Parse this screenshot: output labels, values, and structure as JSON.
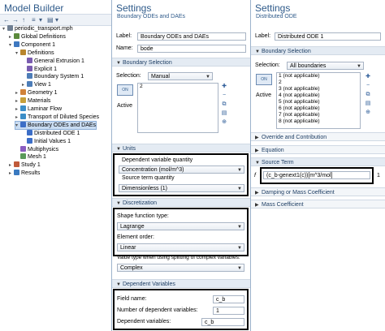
{
  "model_builder": {
    "title": "Model Builder",
    "toolbar": [
      "←",
      "→",
      "↑",
      "≡",
      "▾",
      "▤",
      "▾"
    ],
    "tree": [
      {
        "label": "periodic_transport.mph",
        "level": 0,
        "toggle": "▾",
        "icon": "file-icon",
        "color": "#6f7f92"
      },
      {
        "label": "Global Definitions",
        "level": 1,
        "toggle": "▸",
        "icon": "globe-icon",
        "color": "#5b8a3c"
      },
      {
        "label": "Component 1",
        "level": 1,
        "toggle": "▾",
        "icon": "component-icon",
        "color": "#3e78c0"
      },
      {
        "label": "Definitions",
        "level": 2,
        "toggle": "▾",
        "icon": "definitions-icon",
        "color": "#b8862e"
      },
      {
        "label": "General Extrusion 1",
        "level": 3,
        "toggle": "",
        "icon": "extrusion-icon",
        "color": "#7a5cb0"
      },
      {
        "label": "Explicit 1",
        "level": 3,
        "toggle": "",
        "icon": "explicit-icon",
        "color": "#7a5cb0"
      },
      {
        "label": "Boundary System 1",
        "level": 3,
        "toggle": "",
        "icon": "axis-icon",
        "color": "#4d7db8"
      },
      {
        "label": "View 1",
        "level": 3,
        "toggle": "▸",
        "icon": "view-icon",
        "color": "#4d7db8"
      },
      {
        "label": "Geometry 1",
        "level": 2,
        "toggle": "▸",
        "icon": "geometry-icon",
        "color": "#d0823a"
      },
      {
        "label": "Materials",
        "level": 2,
        "toggle": "▸",
        "icon": "materials-icon",
        "color": "#c7a03a"
      },
      {
        "label": "Laminar Flow",
        "level": 2,
        "toggle": "▸",
        "icon": "flow-icon",
        "color": "#3c8ec7"
      },
      {
        "label": "Transport of Diluted Species",
        "level": 2,
        "toggle": "▸",
        "icon": "species-icon",
        "color": "#3c8ec7"
      },
      {
        "label": "Boundary ODEs and DAEs",
        "level": 2,
        "toggle": "▾",
        "icon": "ode-icon",
        "color": "#3c6ec7",
        "selected": true
      },
      {
        "label": "Distributed ODE 1",
        "level": 3,
        "toggle": "",
        "icon": "ode-node-icon",
        "color": "#3c6ec7"
      },
      {
        "label": "Initial Values 1",
        "level": 3,
        "toggle": "",
        "icon": "initial-values-icon",
        "color": "#3c6ec7"
      },
      {
        "label": "Multiphysics",
        "level": 2,
        "toggle": "",
        "icon": "multiphysics-icon",
        "color": "#8a5cc0"
      },
      {
        "label": "Mesh 1",
        "level": 2,
        "toggle": "",
        "icon": "mesh-icon",
        "color": "#5a9a5a"
      },
      {
        "label": "Study 1",
        "level": 1,
        "toggle": "▸",
        "icon": "study-icon",
        "color": "#c05a3a"
      },
      {
        "label": "Results",
        "level": 1,
        "toggle": "▸",
        "icon": "results-icon",
        "color": "#3a7ac0"
      }
    ]
  },
  "settings1": {
    "title": "Settings",
    "subtitle": "Boundary ODEs and DAEs",
    "label_caption": "Label:",
    "label_value": "Boundary ODEs and DAEs",
    "name_caption": "Name:",
    "name_value": "bode",
    "boundary_selection": {
      "header": "Boundary Selection",
      "selection_caption": "Selection:",
      "selection_value": "Manual",
      "items": [
        "2"
      ],
      "active_label": "Active"
    },
    "units": {
      "header": "Units",
      "dep_caption": "Dependent variable quantity",
      "dep_value": "Concentration (mol/m^3)",
      "src_caption": "Source term quantity",
      "src_value": "Dimensionless (1)"
    },
    "discretization": {
      "header": "Discretization",
      "shape_caption": "Shape function type:",
      "shape_value": "Lagrange",
      "order_caption": "Element order:",
      "order_value": "Linear",
      "value_type_caption": "Value type when using splitting of complex variables:",
      "value_type_value": "Complex"
    },
    "dependent_variables": {
      "header": "Dependent Variables",
      "field_caption": "Field name:",
      "field_value": "c_b",
      "count_caption": "Number of dependent variables:",
      "count_value": "1",
      "vars_caption": "Dependent variables:",
      "vars_value": "c_b"
    }
  },
  "settings2": {
    "title": "Settings",
    "subtitle": "Distributed ODE",
    "label_caption": "Label:",
    "label_value": "Distributed ODE 1",
    "boundary_selection": {
      "header": "Boundary Selection",
      "selection_caption": "Selection:",
      "selection_value": "All boundaries",
      "items": [
        "1 (not applicable)",
        "2",
        "3 (not applicable)",
        "4 (not applicable)",
        "5 (not applicable)",
        "6 (not applicable)",
        "7 (not applicable)",
        "8 (not applicable)"
      ],
      "active_label": "Active"
    },
    "sections": {
      "override": "Override and Contribution",
      "equation": "Equation",
      "source_term": "Source Term",
      "damping": "Damping or Mass Coefficient",
      "mass": "Mass Coefficient"
    },
    "source_term": {
      "symbol": "f",
      "value": "(c_b-genext1(c))[m^3/mol]",
      "unit": "1"
    }
  }
}
